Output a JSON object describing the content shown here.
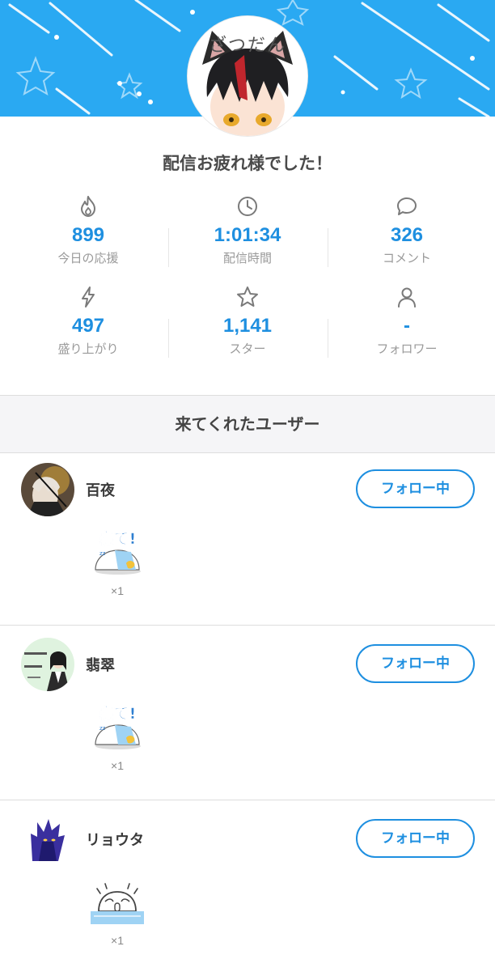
{
  "header": {
    "colors": {
      "banner": "#2aa9f2",
      "accent": "#1e8fe0"
    },
    "avatar_text": "ざつだん"
  },
  "title": "配信お疲れ様でした！",
  "stats": [
    {
      "icon": "flame-icon",
      "value": "899",
      "label": "今日の応援"
    },
    {
      "icon": "clock-icon",
      "value": "1:01:34",
      "label": "配信時間"
    },
    {
      "icon": "comment-bubble-icon",
      "value": "326",
      "label": "コメント"
    },
    {
      "icon": "lightning-icon",
      "value": "497",
      "label": "盛り上がり"
    },
    {
      "icon": "star-icon",
      "value": "1,141",
      "label": "スター"
    },
    {
      "icon": "person-icon",
      "value": "-",
      "label": "フォロワー"
    }
  ],
  "visitors": {
    "heading": "来てくれたユーザー",
    "users": [
      {
        "name": "百夜",
        "follow_label": "フォロー中",
        "gift": "sleep-sticker",
        "gift_text": "寝て!",
        "count": "×1"
      },
      {
        "name": "翡翠",
        "follow_label": "フォロー中",
        "gift": "sleep-sticker",
        "gift_text": "寝て!",
        "count": "×1"
      },
      {
        "name": "リョウタ",
        "follow_label": "フォロー中",
        "gift": "crying-sticker",
        "count": "×1"
      }
    ]
  }
}
